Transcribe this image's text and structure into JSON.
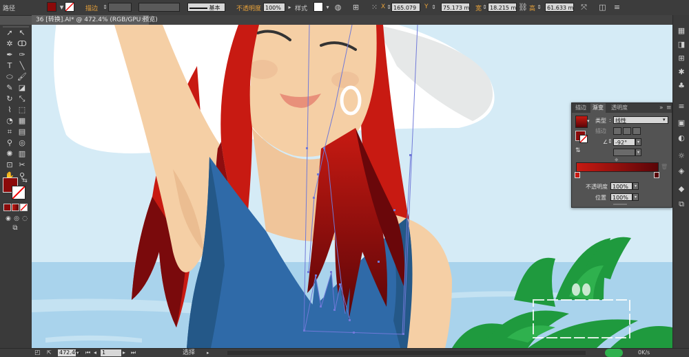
{
  "control_bar": {
    "selection_type": "路径",
    "stroke_label": "描边",
    "stroke_style": "基本",
    "opacity_label": "不透明度",
    "opacity_value": "100%",
    "style_label": "样式",
    "x_label": "X",
    "x_value": "165.079",
    "y_label": "Y",
    "y_value": "75.173 m",
    "w_label": "宽",
    "w_value": "18.215 m",
    "h_label": "高",
    "h_value": "61.633 m",
    "fill_color": "#8b0a0a"
  },
  "document": {
    "tab_title": "36 [转换].AI* @ 472.4% (RGB/GPU 预览)",
    "close": "×"
  },
  "tools_panel": {
    "fill_color": "#8b0a0a",
    "tools": [
      "selection-tool",
      "direct-selection-tool",
      "magic-wand-tool",
      "lasso-tool",
      "pen-tool",
      "curvature-tool",
      "type-tool",
      "line-tool",
      "rectangle-tool",
      "paintbrush-tool",
      "pencil-tool",
      "eraser-tool",
      "rotate-tool",
      "scale-tool",
      "warp-tool",
      "free-transform-tool",
      "shape-builder-tool",
      "perspective-tool",
      "mesh-tool",
      "gradient-tool",
      "eyedropper-tool",
      "blend-tool",
      "symbol-sprayer-tool",
      "graph-tool",
      "artboard-tool",
      "slice-tool",
      "hand-tool",
      "zoom-tool"
    ]
  },
  "gradient_panel": {
    "tabs": [
      "描边",
      "渐变",
      "透明度"
    ],
    "active_tab": "渐变",
    "type_label": "类型",
    "type_value": "线性",
    "stroke_label": "描边",
    "angle_value": "-92°",
    "opacity_label": "不透明度",
    "opacity_value": "100%",
    "position_label": "位置",
    "position_value": "100%",
    "gradient_start": "#c81a12",
    "gradient_end": "#5a0508"
  },
  "status_bar": {
    "zoom": "472.4%",
    "artboard": "1",
    "tool_name": "选择",
    "speed": "0K/s"
  },
  "colors": {
    "hair": "#c81a12",
    "hair_dark": "#5a0508",
    "skin": "#f5cfa5",
    "dress": "#2f6aa8",
    "sky": "#d5ebf6",
    "sea": "#a9d3ec",
    "hat": "#e6e8e8",
    "leaves": "#1f9a3e",
    "path": "#7079d8"
  }
}
